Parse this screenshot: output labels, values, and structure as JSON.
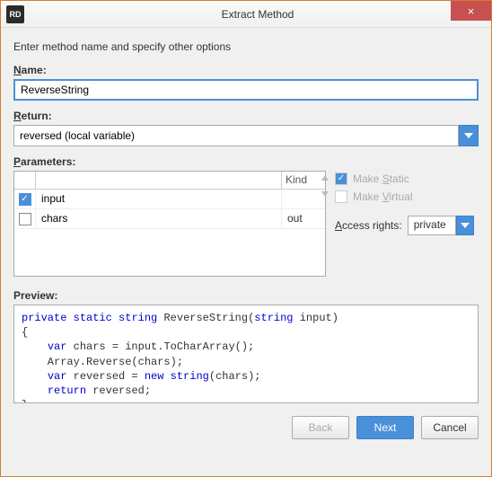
{
  "window": {
    "app_icon_text": "RD",
    "title": "Extract Method",
    "close_label": "×"
  },
  "intro": "Enter method name and specify other options",
  "name": {
    "label_html": "Name:",
    "label_underline_char": "N",
    "value": "ReverseString"
  },
  "return": {
    "label_underline_char": "R",
    "label_rest": "eturn:",
    "value": "reversed (local variable)"
  },
  "parameters": {
    "label_underline_char": "P",
    "label_rest": "arameters:",
    "headers": {
      "kind": "Kind"
    },
    "rows": [
      {
        "checked": true,
        "name": "input",
        "kind": ""
      },
      {
        "checked": false,
        "name": "chars",
        "kind": "out"
      }
    ]
  },
  "options": {
    "make_static": {
      "label": "Make Static",
      "underline_char": "S",
      "prefix": "Make ",
      "suffix": "tatic",
      "checked": true,
      "enabled": false
    },
    "make_virtual": {
      "label": "Make Virtual",
      "underline_char": "V",
      "prefix": "Make ",
      "suffix": "irtual",
      "checked": false,
      "enabled": false
    },
    "access_label_underline": "A",
    "access_label_rest": "ccess rights:",
    "access_value": "private"
  },
  "preview": {
    "label": "Preview:",
    "tokens": [
      {
        "t": "kw",
        "v": "private"
      },
      {
        "t": "sp",
        "v": " "
      },
      {
        "t": "kw",
        "v": "static"
      },
      {
        "t": "sp",
        "v": " "
      },
      {
        "t": "kw",
        "v": "string"
      },
      {
        "t": "sp",
        "v": " "
      },
      {
        "t": "plain",
        "v": "ReverseString("
      },
      {
        "t": "kw",
        "v": "string"
      },
      {
        "t": "sp",
        "v": " "
      },
      {
        "t": "plain",
        "v": "input)"
      },
      {
        "t": "nl"
      },
      {
        "t": "plain",
        "v": "{"
      },
      {
        "t": "nl"
      },
      {
        "t": "plain",
        "v": "    "
      },
      {
        "t": "kw",
        "v": "var"
      },
      {
        "t": "plain",
        "v": " chars = input.ToCharArray();"
      },
      {
        "t": "nl"
      },
      {
        "t": "plain",
        "v": "    Array.Reverse(chars);"
      },
      {
        "t": "nl"
      },
      {
        "t": "plain",
        "v": "    "
      },
      {
        "t": "kw",
        "v": "var"
      },
      {
        "t": "plain",
        "v": " reversed = "
      },
      {
        "t": "kw",
        "v": "new"
      },
      {
        "t": "sp",
        "v": " "
      },
      {
        "t": "kw",
        "v": "string"
      },
      {
        "t": "plain",
        "v": "(chars);"
      },
      {
        "t": "nl"
      },
      {
        "t": "plain",
        "v": "    "
      },
      {
        "t": "kw",
        "v": "return"
      },
      {
        "t": "plain",
        "v": " reversed;"
      },
      {
        "t": "nl"
      },
      {
        "t": "plain",
        "v": "}"
      }
    ]
  },
  "buttons": {
    "back": "Back",
    "next": "Next",
    "cancel": "Cancel"
  }
}
